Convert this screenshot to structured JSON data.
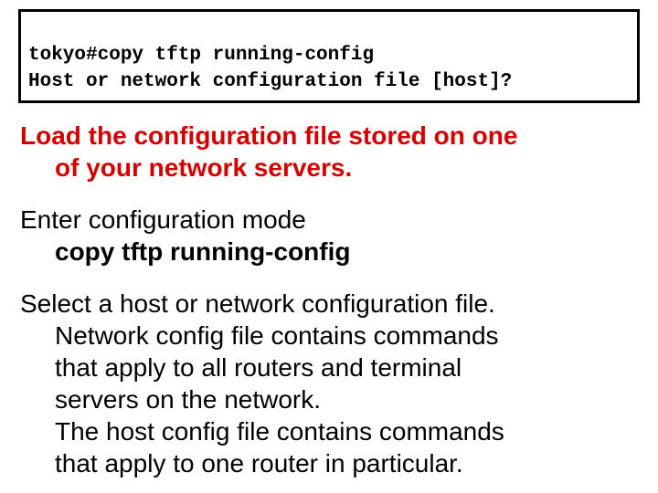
{
  "terminal": {
    "line1": "tokyo#copy tftp running-config",
    "line2": "Host or network configuration file [host]?"
  },
  "section1": {
    "line1": "Load the configuration file stored on one",
    "line2": "of your network servers."
  },
  "section2": {
    "line1": "Enter configuration mode",
    "line2": "copy tftp running-config"
  },
  "section3": {
    "line1": "Select a host or network configuration file.",
    "line2": "Network config file contains commands",
    "line3": "that apply to all routers and terminal",
    "line4": "servers on the network.",
    "line5": "The host config file contains commands",
    "line6": "that apply to one router in particular."
  }
}
